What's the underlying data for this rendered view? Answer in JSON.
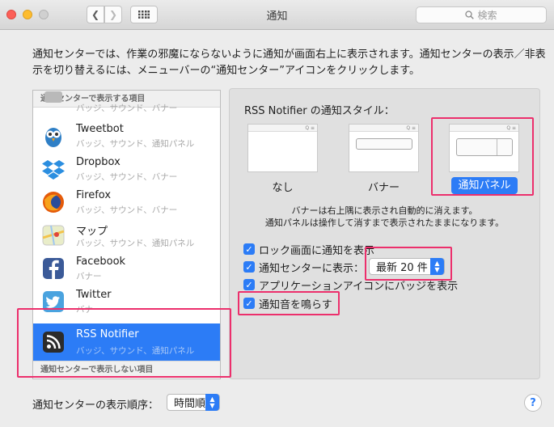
{
  "window": {
    "title": "通知"
  },
  "search": {
    "placeholder": "検索"
  },
  "description": "通知センターでは、作業の邪魔にならないように通知が画面右上に表示されます。通知センターの表示／非表示を切り替えるには、メニューバーの“通知センター”アイコンをクリックします。",
  "app_list": {
    "section_shown": "通知センターで表示する項目",
    "section_hidden": "通知センターで表示しない項目",
    "partial_row_sub": "バッジ、サウンド、バナー",
    "items": [
      {
        "name": "Tweetbot",
        "sub": "バッジ、サウンド、通知パネル",
        "icon": "tweetbot-icon"
      },
      {
        "name": "Dropbox",
        "sub": "バッジ、サウンド、バナー",
        "icon": "dropbox-icon"
      },
      {
        "name": "Firefox",
        "sub": "バッジ、サウンド、バナー",
        "icon": "firefox-icon"
      },
      {
        "name": "マップ",
        "sub": "バッジ、サウンド、通知パネル",
        "icon": "maps-icon"
      },
      {
        "name": "Facebook",
        "sub": "バナー",
        "icon": "facebook-icon"
      },
      {
        "name": "Twitter",
        "sub": "バナー",
        "icon": "twitter-icon"
      },
      {
        "name": "RSS Notifier",
        "sub": "バッジ、サウンド、通知パネル",
        "icon": "rss-icon",
        "selected": true
      }
    ]
  },
  "style_panel": {
    "header": "RSS Notifier の通知スタイル：",
    "styles": [
      "なし",
      "バナー",
      "通知パネル"
    ],
    "selected_style": "通知パネル",
    "note_line1": "バナーは右上隅に表示され自動的に消えます。",
    "note_line2": "通知パネルは操作して消すまで表示されたままになります。",
    "thumb_bar": "Q ≡",
    "options": {
      "lock_screen": "ロック画面に通知を表示",
      "show_in_nc": "通知センターに表示：",
      "nc_count": "最新 20 件",
      "badge": "アプリケーションアイコンにバッジを表示",
      "sound": "通知音を鳴らす"
    }
  },
  "bottom": {
    "sort_label": "通知センターの表示順序：",
    "sort_value": "時間順",
    "help": "?"
  },
  "colors": {
    "accent": "#2c7cf6",
    "highlight": "#ec2f6c"
  }
}
